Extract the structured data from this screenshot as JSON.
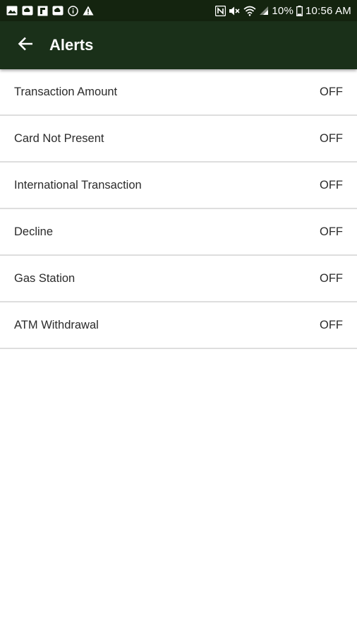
{
  "status_bar": {
    "left_icons": [
      "image-icon",
      "cloud-sync-icon",
      "flipboard-icon",
      "cloud-sync-icon",
      "info-icon",
      "warning-icon"
    ],
    "right_icons": [
      "nfc-icon",
      "mute-icon",
      "wifi-icon",
      "signal-icon",
      "battery-icon"
    ],
    "battery": "10%",
    "time": "10:56 AM"
  },
  "app_bar": {
    "back_icon": "arrow-left-icon",
    "title": "Alerts"
  },
  "alerts": [
    {
      "label": "Transaction Amount",
      "value": "OFF"
    },
    {
      "label": "Card Not Present",
      "value": "OFF"
    },
    {
      "label": "International Transaction",
      "value": "OFF"
    },
    {
      "label": "Decline",
      "value": "OFF"
    },
    {
      "label": "Gas Station",
      "value": "OFF"
    },
    {
      "label": "ATM Withdrawal",
      "value": "OFF"
    }
  ],
  "colors": {
    "status_bar_bg": "#14240f",
    "app_bar_bg": "#1a3019",
    "divider": "#dedede",
    "text": "#2b2b2b"
  }
}
